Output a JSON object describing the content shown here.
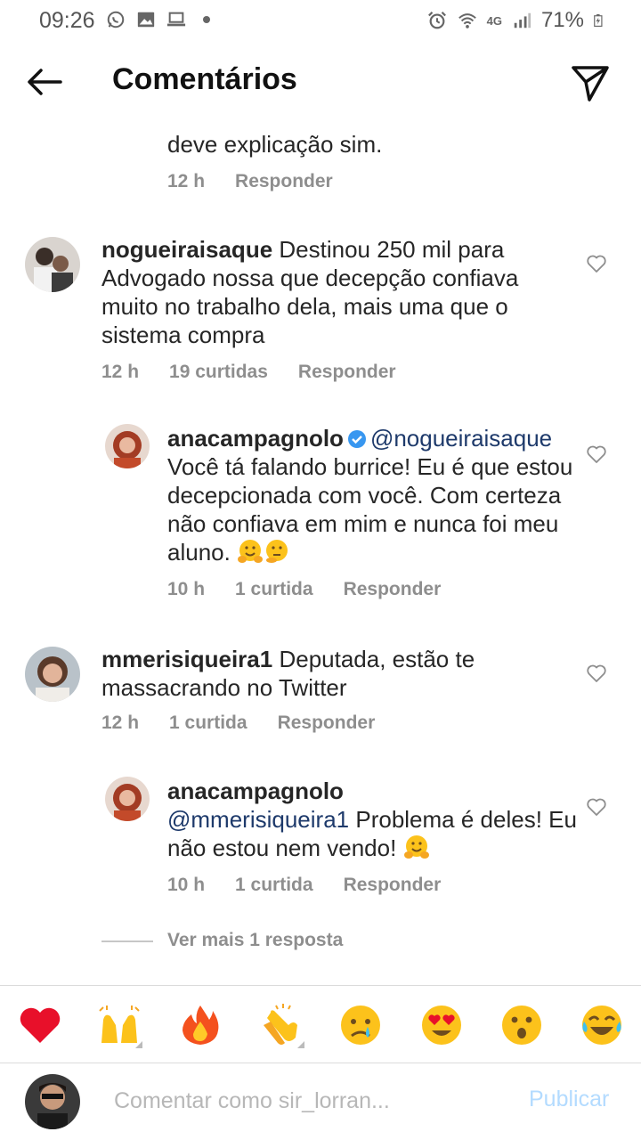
{
  "status_bar": {
    "time": "09:26",
    "network": "4G",
    "battery": "71%"
  },
  "header": {
    "title": "Comentários"
  },
  "comments": [
    {
      "text": "deve explicação sim.",
      "time": "12 h",
      "reply_label": "Responder"
    },
    {
      "user": "nogueiraisaque",
      "text": "Destinou 250 mil para Advogado nossa que decepção confiava muito no trabalho dela, mais uma que o sistema compra",
      "time": "12 h",
      "likes": "19 curtidas",
      "reply_label": "Responder"
    },
    {
      "user": "anacampagnolo",
      "mention": "@nogueiraisaque",
      "text": "Você tá falando burrice! Eu é que estou decepcionada com você. Com certeza não confiava em mim e nunca foi meu aluno.",
      "time": "10 h",
      "likes": "1 curtida",
      "reply_label": "Responder"
    },
    {
      "user": "mmerisiqueira1",
      "text": "Deputada, estão te massacrando no Twitter",
      "time": "12 h",
      "likes": "1 curtida",
      "reply_label": "Responder"
    },
    {
      "user": "anacampagnolo",
      "mention": "@mmerisiqueira1",
      "text": "Problema é deles! Eu não estou nem vendo!",
      "time": "10 h",
      "likes": "1 curtida",
      "reply_label": "Responder"
    }
  ],
  "view_more": "Ver mais 1 resposta",
  "reactions": [
    "red-heart",
    "raising-hands",
    "fire",
    "clapping-hands",
    "crying-face",
    "heart-eyes-face",
    "surprised-face",
    "tears-of-joy-face"
  ],
  "composer": {
    "placeholder": "Comentar como sir_lorran...",
    "publish_label": "Publicar"
  },
  "colors": {
    "mention": "#1e3a6b",
    "publish": "#b3dbff",
    "meta": "#8e8e8e"
  }
}
